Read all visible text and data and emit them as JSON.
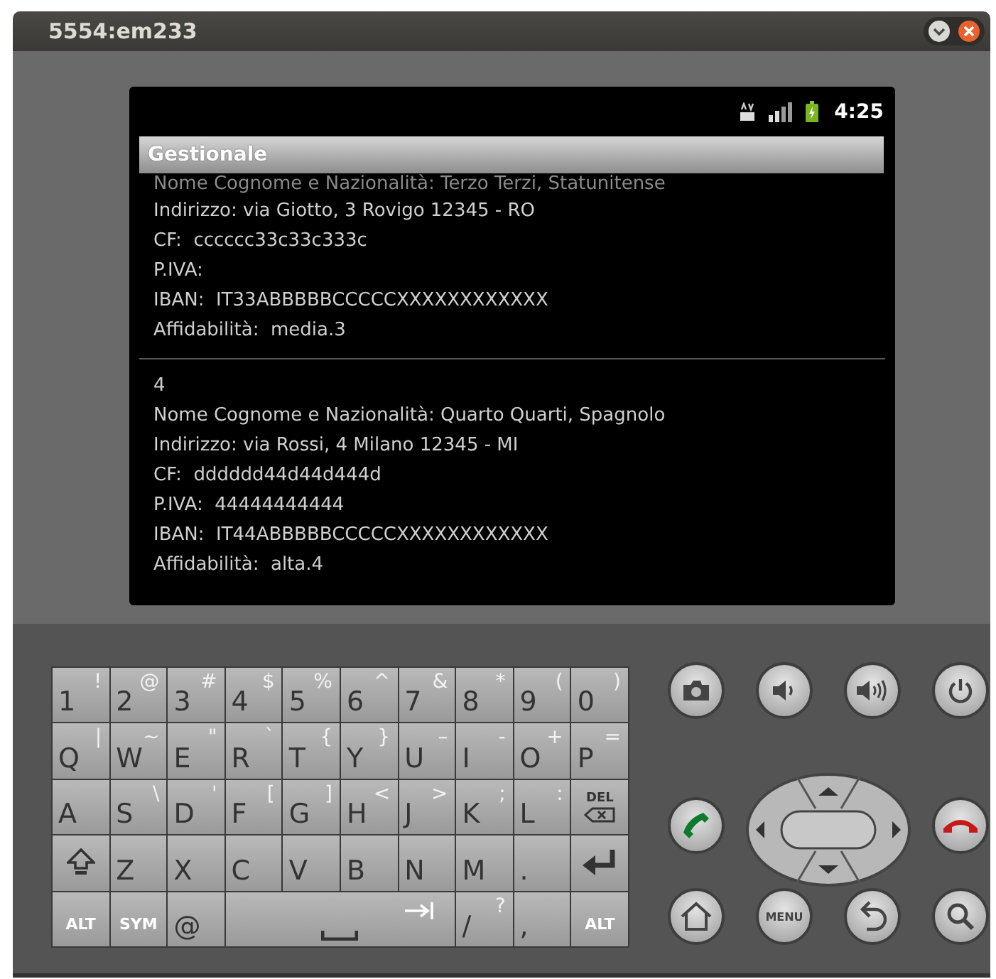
{
  "window": {
    "title": "5554:em233"
  },
  "status_bar": {
    "time": "4:25"
  },
  "app": {
    "title": "Gestionale"
  },
  "records": [
    {
      "lines": [
        "Nome Cognome e Nazionalità: Terzo Terzi, Statunitense",
        "Indirizzo: via Giotto, 3 Rovigo 12345 - RO",
        "CF:  cccccc33c33c333c",
        "P.IVA:",
        "IBAN:  IT33ABBBBBCCCCCXXXXXXXXXXXX",
        "Affidabilità:  media.3"
      ]
    },
    {
      "lines": [
        "4",
        "Nome Cognome e Nazionalità: Quarto Quarti, Spagnolo",
        "Indirizzo: via Rossi, 4 Milano 12345 - MI",
        "CF:  dddddd44d44d444d",
        "P.IVA:  44444444444",
        "IBAN:  IT44ABBBBBCCCCCXXXXXXXXXXXX",
        "Affidabilità:  alta.4"
      ]
    }
  ],
  "keyboard": [
    [
      {
        "kind": "char",
        "main": "1",
        "alt": "!"
      },
      {
        "kind": "char",
        "main": "2",
        "alt": "@"
      },
      {
        "kind": "char",
        "main": "3",
        "alt": "#"
      },
      {
        "kind": "char",
        "main": "4",
        "alt": "$"
      },
      {
        "kind": "char",
        "main": "5",
        "alt": "%"
      },
      {
        "kind": "char",
        "main": "6",
        "alt": "^"
      },
      {
        "kind": "char",
        "main": "7",
        "alt": "&"
      },
      {
        "kind": "char",
        "main": "8",
        "alt": "*"
      },
      {
        "kind": "char",
        "main": "9",
        "alt": "("
      },
      {
        "kind": "char",
        "main": "0",
        "alt": ")"
      }
    ],
    [
      {
        "kind": "char",
        "main": "Q",
        "alt": "|"
      },
      {
        "kind": "char",
        "main": "W",
        "alt": "~"
      },
      {
        "kind": "char",
        "main": "E",
        "alt": "\""
      },
      {
        "kind": "char",
        "main": "R",
        "alt": "`"
      },
      {
        "kind": "char",
        "main": "T",
        "alt": "{"
      },
      {
        "kind": "char",
        "main": "Y",
        "alt": "}"
      },
      {
        "kind": "char",
        "main": "U",
        "alt": "–"
      },
      {
        "kind": "char",
        "main": "I",
        "alt": "-"
      },
      {
        "kind": "char",
        "main": "O",
        "alt": "+"
      },
      {
        "kind": "char",
        "main": "P",
        "alt": "="
      }
    ],
    [
      {
        "kind": "char",
        "main": "A"
      },
      {
        "kind": "char",
        "main": "S",
        "alt": "\\"
      },
      {
        "kind": "char",
        "main": "D",
        "alt": "'"
      },
      {
        "kind": "char",
        "main": "F",
        "alt": "["
      },
      {
        "kind": "char",
        "main": "G",
        "alt": "]"
      },
      {
        "kind": "char",
        "main": "H",
        "alt": "<"
      },
      {
        "kind": "char",
        "main": "J",
        "alt": ">"
      },
      {
        "kind": "char",
        "main": "K",
        "alt": ";"
      },
      {
        "kind": "char",
        "main": "L",
        "alt": ":"
      },
      {
        "kind": "del",
        "main": "DEL"
      }
    ],
    [
      {
        "kind": "shift"
      },
      {
        "kind": "char",
        "main": "Z"
      },
      {
        "kind": "char",
        "main": "X"
      },
      {
        "kind": "char",
        "main": "C"
      },
      {
        "kind": "char",
        "main": "V"
      },
      {
        "kind": "char",
        "main": "B"
      },
      {
        "kind": "char",
        "main": "N"
      },
      {
        "kind": "char",
        "main": "M"
      },
      {
        "kind": "char",
        "main": "."
      },
      {
        "kind": "enter"
      }
    ],
    [
      {
        "kind": "mod",
        "main": "ALT"
      },
      {
        "kind": "mod",
        "main": "SYM"
      },
      {
        "kind": "char",
        "main": "@"
      },
      {
        "kind": "space"
      },
      {
        "kind": "char",
        "main": "/",
        "alt": "?"
      },
      {
        "kind": "char",
        "main": ","
      },
      {
        "kind": "mod",
        "main": "ALT"
      }
    ]
  ],
  "hardware_buttons": [
    {
      "kind": "camera"
    },
    {
      "kind": "volume-down"
    },
    {
      "kind": "volume-up"
    },
    {
      "kind": "power"
    },
    {
      "kind": "call"
    },
    {
      "kind": "dpad"
    },
    {
      "kind": "end-call"
    },
    {
      "kind": "home"
    },
    {
      "kind": "menu",
      "label": "MENU"
    },
    {
      "kind": "back"
    },
    {
      "kind": "search"
    }
  ]
}
